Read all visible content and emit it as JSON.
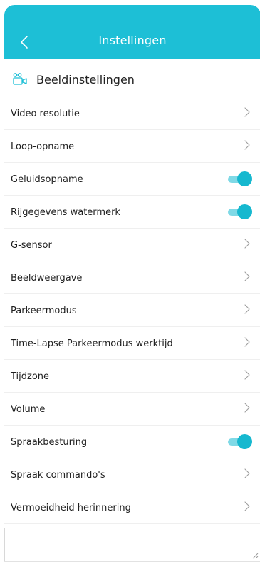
{
  "header": {
    "title": "Instellingen",
    "back_icon": "chevron-left-icon"
  },
  "section": {
    "title": "Beeldinstellingen",
    "icon": "camera-settings-icon"
  },
  "colors": {
    "accent": "#1dbfd6",
    "toggle_track": "#7fd9e6",
    "toggle_knob": "#16b8cf"
  },
  "rows": [
    {
      "label": "Video resolutie",
      "control": "chevron"
    },
    {
      "label": "Loop-opname",
      "control": "chevron"
    },
    {
      "label": "Geluidsopname",
      "control": "toggle",
      "on": true
    },
    {
      "label": "Rijgegevens watermerk",
      "control": "toggle",
      "on": true
    },
    {
      "label": "G-sensor",
      "control": "chevron"
    },
    {
      "label": "Beeldweergave",
      "control": "chevron"
    },
    {
      "label": "Parkeermodus",
      "control": "chevron"
    },
    {
      "label": "Time-Lapse Parkeermodus werktijd",
      "control": "chevron"
    },
    {
      "label": "Tijdzone",
      "control": "chevron"
    },
    {
      "label": "Volume",
      "control": "chevron"
    },
    {
      "label": "Spraakbesturing",
      "control": "toggle",
      "on": true
    },
    {
      "label": "Spraak commando's",
      "control": "chevron"
    },
    {
      "label": "Vermoeidheid herinnering",
      "control": "chevron"
    }
  ]
}
